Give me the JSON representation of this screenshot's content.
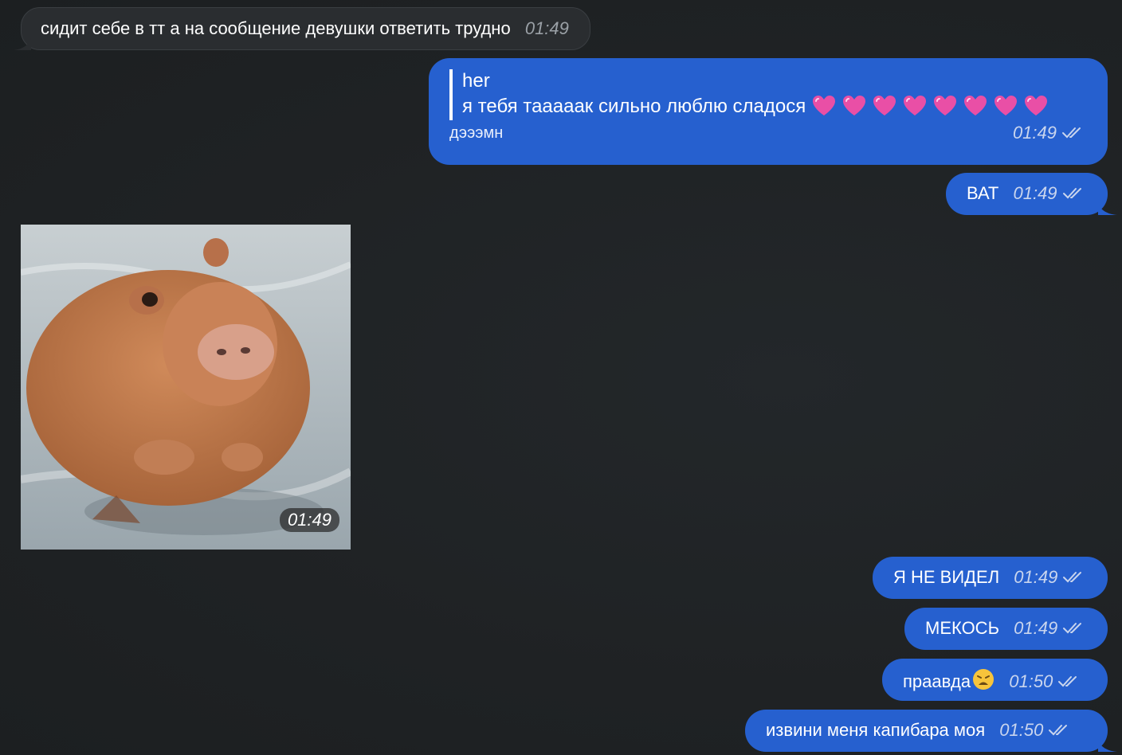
{
  "messages": [
    {
      "id": "m1",
      "direction": "incoming",
      "text": "сидит себе в тт а на сообщение девушки ответить трудно",
      "time": "01:49"
    },
    {
      "id": "m2",
      "direction": "outgoing",
      "reply_author": "her",
      "reply_text": "я тебя таааaак сильно люблю сладося",
      "text": "дэээмн",
      "time": "01:49"
    },
    {
      "id": "m3",
      "direction": "outgoing",
      "text": "ВАТ",
      "time": "01:49"
    },
    {
      "id": "m4",
      "direction": "incoming",
      "type": "photo",
      "photo_subject": "capybara-in-water",
      "time": "01:49"
    },
    {
      "id": "m5",
      "direction": "outgoing",
      "text": "Я НЕ ВИДЕЛ",
      "time": "01:49"
    },
    {
      "id": "m6",
      "direction": "outgoing",
      "text": "МЕКОСЬ",
      "time": "01:49"
    },
    {
      "id": "m7",
      "direction": "outgoing",
      "text": "праавда",
      "emoji": "weary-face-icon",
      "time": "01:50"
    },
    {
      "id": "m8",
      "direction": "outgoing",
      "text": "извини меня капибара моя",
      "time": "01:50"
    }
  ],
  "colors": {
    "background": "#212426",
    "outgoing_bubble": "#2660cf",
    "incoming_bubble": "#2a2d30",
    "heart_emoji": "#e94fa6"
  },
  "reply_hearts_count": 8,
  "read_status_icon": "double-check-icon"
}
